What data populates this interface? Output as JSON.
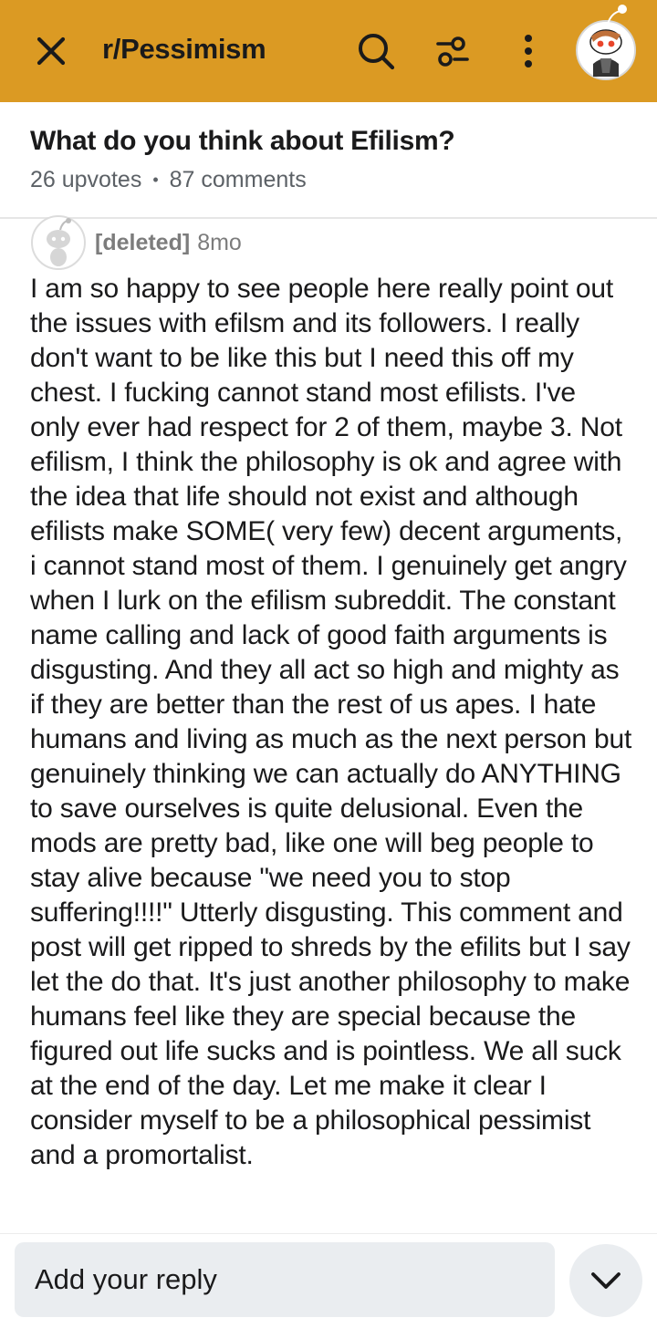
{
  "header": {
    "subreddit": "r/Pessimism",
    "icons": [
      "close-icon",
      "search-icon",
      "filter-icon",
      "more-vertical-icon",
      "user-avatar"
    ],
    "color": "#db9a23"
  },
  "post": {
    "title": "What do you think about Efilism?",
    "upvotes": "26 upvotes",
    "separator": "•",
    "comments": "87 comments"
  },
  "comment": {
    "user": "[deleted]",
    "age": "8mo",
    "body": "I am so happy to see people here really point out the issues with efilsm and its followers. I really don't want to be like this but I need this off my chest. I fucking cannot stand most efilists. I've only ever had respect for 2 of them, maybe 3. Not efilism, I think the philosophy is ok and agree with the idea that life should not exist and although efilists make SOME( very few) decent arguments, i cannot stand most of them. I genuinely get angry when I lurk on the efilism subreddit. The constant name calling and lack of good faith arguments is disgusting. And they all act so high and mighty as if they are better than the rest of us apes. I hate humans and living as much as the next person but genuinely thinking we can actually do ANYTHING to save ourselves is quite delusional. Even the mods are pretty bad, like one will beg people to stay alive because \"we need you to stop suffering!!!!\" Utterly disgusting. This comment and post will get ripped to shreds by the efilits but I say let the do that. It's just another philosophy to make humans feel like they are special because the figured out life sucks and is pointless. We all suck at the end of the day. Let me make it clear I consider myself to be a philosophical pessimist and a promortalist."
  },
  "reply": {
    "placeholder": "Add your reply"
  }
}
